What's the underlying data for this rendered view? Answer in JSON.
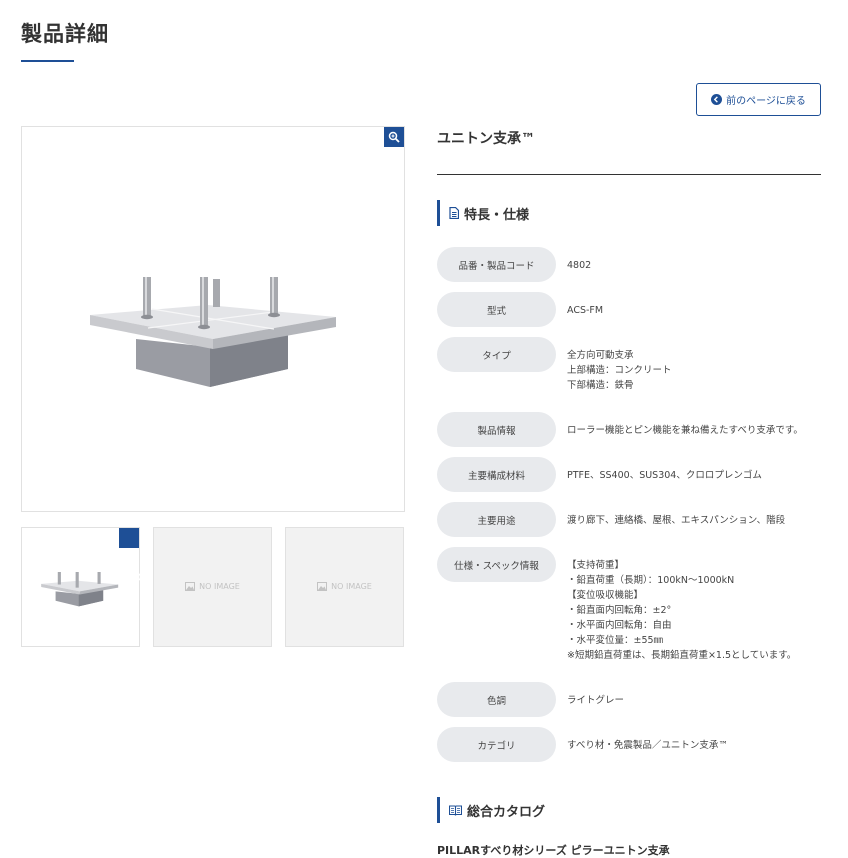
{
  "page": {
    "title": "製品詳細"
  },
  "back_button": {
    "label": "前のページに戻る"
  },
  "gallery": {
    "no_image_label": "NO IMAGE"
  },
  "product": {
    "name": "ユニトン支承™"
  },
  "specs_section": {
    "title": "特長・仕様"
  },
  "specs": [
    {
      "label": "品番・製品コード",
      "value": [
        "4802"
      ]
    },
    {
      "label": "型式",
      "value": [
        "ACS-FM"
      ]
    },
    {
      "label": "タイプ",
      "value": [
        "全方向可動支承",
        "上部構造：コンクリート",
        "下部構造：鉄骨"
      ]
    },
    {
      "label": "製品情報",
      "value": [
        "ローラー機能とピン機能を兼ね備えたすべり支承です。"
      ]
    },
    {
      "label": "主要構成材料",
      "value": [
        "PTFE、SS400、SUS304、クロロプレンゴム"
      ]
    },
    {
      "label": "主要用途",
      "value": [
        "渡り廊下、連絡橋、屋根、エキスパンション、階段"
      ]
    },
    {
      "label": "仕様・スペック情報",
      "value": [
        "【支持荷重】",
        "・鉛直荷重（長期）：100kN〜1000kN",
        "【変位吸収機能】",
        "・鉛直面内回転角：±2°",
        "・水平面内回転角：自由",
        "・水平変位量：±55㎜",
        "※短期鉛直荷重は、長期鉛直荷重×1.5としています。"
      ]
    },
    {
      "label": "色調",
      "value": [
        "ライトグレー"
      ]
    },
    {
      "label": "カテゴリ",
      "value": [
        "すべり材・免震製品／ユニトン支承™"
      ]
    }
  ],
  "catalog_section": {
    "title": "総合カタログ"
  },
  "catalog": {
    "item_title": "PILLARすべり材シリーズ ピラーユニトン支承"
  },
  "colors": {
    "accent": "#1e4f96",
    "label_bg": "#e8eaed",
    "thumb_bg": "#f2f2f2"
  }
}
